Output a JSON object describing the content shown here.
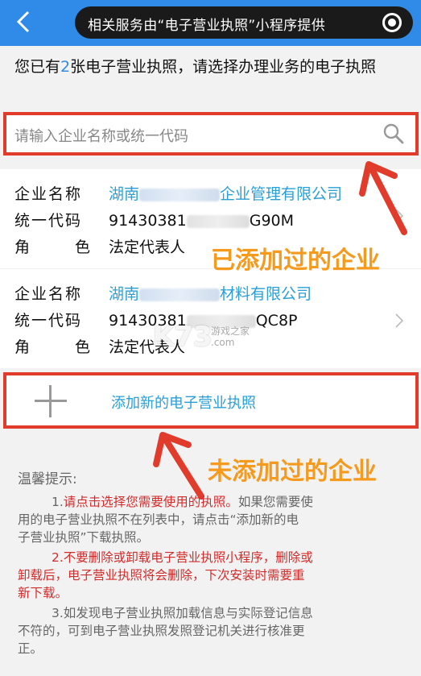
{
  "topbar": {
    "back_glyph": "<",
    "mini_banner": "相关服务由“电子营业执照”小程序提供"
  },
  "intro": {
    "prefix": "您已有",
    "count": "2",
    "suffix": "张电子营业执照，请选择办理业务的电子执照"
  },
  "search": {
    "placeholder": "请输入企业名称或统一代码"
  },
  "cards": [
    {
      "name_label": "企业名称",
      "name_prefix": "湖南",
      "name_suffix": "企业管理有限公司",
      "code_label": "统一代码",
      "code_prefix": "91430381",
      "code_suffix": "G90M",
      "role_label_1": "角",
      "role_label_2": "色",
      "role_value": "法定代表人"
    },
    {
      "name_label": "企业名称",
      "name_prefix": "湖南",
      "name_suffix": "材料有限公司",
      "code_label": "统一代码",
      "code_prefix": "91430381",
      "code_suffix": "QC8P",
      "role_label_1": "角",
      "role_label_2": "色",
      "role_value": "法定代表人"
    }
  ],
  "add": {
    "label": "添加新的电子营业执照"
  },
  "annotations": {
    "added": "已添加过的企业",
    "not_added": "未添加过的企业"
  },
  "tips": {
    "title": "温馨提示:",
    "tip1_num": "1.",
    "tip1_red": "请点击选择您需要使用的执照。",
    "tip1_rest_a": "如果您需要使",
    "tip1_line2": "用的电子营业执照不在列表中，请点击“添加新的电",
    "tip1_line3": "子营业执照”下载执照。",
    "tip2_line1": "2.不要删除或卸载电子营业执照小程序，删除或",
    "tip2_line2": "卸载后，电子营业执照将会删除，下次安装时需要重",
    "tip2_line3": "新下载。",
    "tip3_line1": "3.如发现电子营业执照加载信息与实际登记信息",
    "tip3_line2": "不符的，可到电子营业执照发照登记机关进行核准更",
    "tip3_line3": "正。"
  },
  "watermark": {
    "logo": "K73",
    "sub1": "游戏之家",
    "sub2": ".com"
  },
  "colors": {
    "topbar": "#2f8ae8",
    "highlight_border": "#e13b2c",
    "annotation": "#f59a1d",
    "company_link": "#2a9fd6",
    "tip_red": "#d42b2b"
  }
}
